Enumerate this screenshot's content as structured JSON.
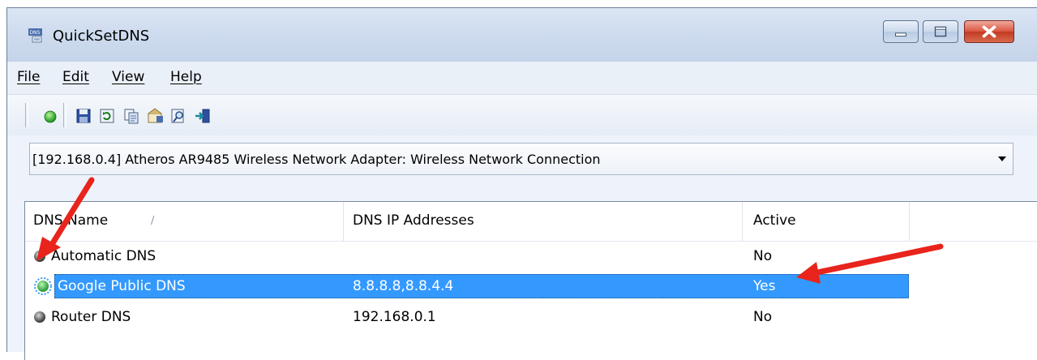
{
  "window": {
    "title": "QuickSetDNS",
    "icon": "dns-app-icon"
  },
  "menu": {
    "file": "File",
    "edit": "Edit",
    "view": "View",
    "help": "Help"
  },
  "toolbar": {
    "buttons": [
      "green-circle-icon",
      "save-icon",
      "refresh-icon",
      "copy-icon",
      "properties-icon",
      "find-icon",
      "exit-icon"
    ]
  },
  "adapter": {
    "selected": "[192.168.0.4]  Atheros AR9485 Wireless Network Adapter: Wireless Network Connection"
  },
  "list": {
    "columns": [
      "DNS Name",
      "DNS IP Addresses",
      "Active"
    ],
    "sort_indicator": "/",
    "rows": [
      {
        "name": "Automatic DNS",
        "ip": "",
        "active": "No",
        "status": "gray"
      },
      {
        "name": "Google Public DNS",
        "ip": "8.8.8.8,8.8.4.4",
        "active": "Yes",
        "status": "green"
      },
      {
        "name": "Router DNS",
        "ip": "192.168.0.1",
        "active": "No",
        "status": "gray"
      }
    ]
  },
  "colors": {
    "selection": "#3399ff",
    "annotation_arrow": "#e8241c",
    "active_dot": "#3cb44a"
  }
}
